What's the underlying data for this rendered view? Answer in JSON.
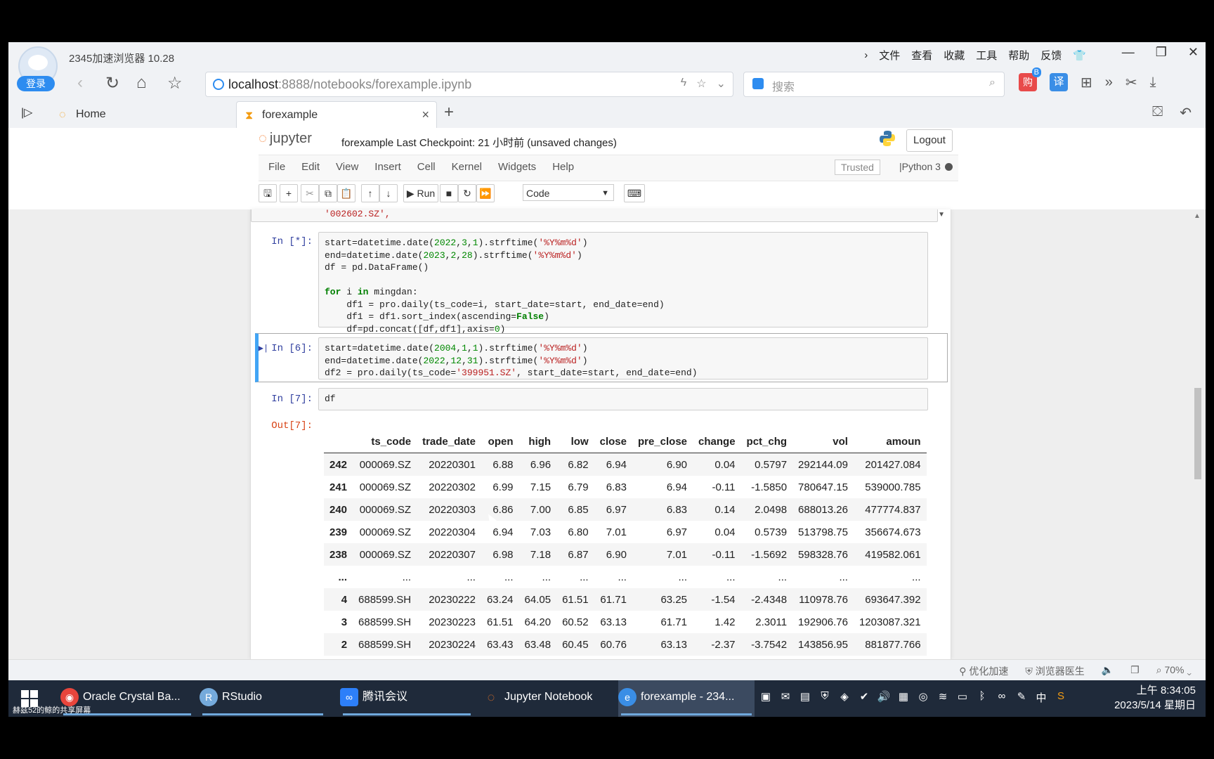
{
  "browser": {
    "title": "2345加速浏览器 10.28",
    "login": "登录",
    "url_host": "localhost",
    "url_rest": ":8888/notebooks/forexample.ipynb",
    "search_placeholder": "搜索",
    "menu": [
      "文件",
      "查看",
      "收藏",
      "工具",
      "帮助",
      "反馈"
    ],
    "red_badge": "B",
    "red_label": "购",
    "blue_label": "译",
    "tabs": [
      {
        "label": "Home"
      },
      {
        "label": "forexample"
      }
    ]
  },
  "jupyter": {
    "logo": "jupyter",
    "notebook_title": "forexample",
    "checkpoint": "Last Checkpoint: 21 小时前  (unsaved changes)",
    "logout": "Logout",
    "menus": [
      "File",
      "Edit",
      "View",
      "Insert",
      "Cell",
      "Kernel",
      "Widgets",
      "Help"
    ],
    "trusted": "Trusted",
    "kernel": "Python 3",
    "run_label": "Run",
    "cell_type": "Code"
  },
  "cells": {
    "partial_line": "'002602.SZ',",
    "c1_prompt": "In [*]:",
    "c2_prompt": "In [6]:",
    "c3_prompt": "In [7]:",
    "c3_code": "df",
    "out_prompt": "Out[7]:"
  },
  "table": {
    "columns": [
      "ts_code",
      "trade_date",
      "open",
      "high",
      "low",
      "close",
      "pre_close",
      "change",
      "pct_chg",
      "vol",
      "amoun"
    ],
    "rows": [
      [
        "242",
        "000069.SZ",
        "20220301",
        "6.88",
        "6.96",
        "6.82",
        "6.94",
        "6.90",
        "0.04",
        "0.5797",
        "292144.09",
        "201427.084"
      ],
      [
        "241",
        "000069.SZ",
        "20220302",
        "6.99",
        "7.15",
        "6.79",
        "6.83",
        "6.94",
        "-0.11",
        "-1.5850",
        "780647.15",
        "539000.785"
      ],
      [
        "240",
        "000069.SZ",
        "20220303",
        "6.86",
        "7.00",
        "6.85",
        "6.97",
        "6.83",
        "0.14",
        "2.0498",
        "688013.26",
        "477774.837"
      ],
      [
        "239",
        "000069.SZ",
        "20220304",
        "6.94",
        "7.03",
        "6.80",
        "7.01",
        "6.97",
        "0.04",
        "0.5739",
        "513798.75",
        "356674.673"
      ],
      [
        "238",
        "000069.SZ",
        "20220307",
        "6.98",
        "7.18",
        "6.87",
        "6.90",
        "7.01",
        "-0.11",
        "-1.5692",
        "598328.76",
        "419582.061"
      ],
      [
        "...",
        "...",
        "...",
        "...",
        "...",
        "...",
        "...",
        "...",
        "...",
        "...",
        "...",
        "..."
      ],
      [
        "4",
        "688599.SH",
        "20230222",
        "63.24",
        "64.05",
        "61.51",
        "61.71",
        "63.25",
        "-1.54",
        "-2.4348",
        "110978.76",
        "693647.392"
      ],
      [
        "3",
        "688599.SH",
        "20230223",
        "61.51",
        "64.20",
        "60.52",
        "63.13",
        "61.71",
        "1.42",
        "2.3011",
        "192906.76",
        "1203087.321"
      ],
      [
        "2",
        "688599.SH",
        "20230224",
        "63.43",
        "63.48",
        "60.45",
        "60.76",
        "63.13",
        "-2.37",
        "-3.7542",
        "143856.95",
        "881877.766"
      ]
    ]
  },
  "statusbar": [
    "优化加速",
    "浏览器医生",
    "70%"
  ],
  "taskbar": {
    "share_note": "赫兹52的鲸的共享屏幕",
    "items": [
      "Oracle Crystal Ba...",
      "RStudio",
      "腾讯会议",
      "Jupyter Notebook",
      "forexample - 234..."
    ],
    "ime": "中",
    "time": "上午 8:34:05",
    "date": "2023/5/14 星期日"
  }
}
